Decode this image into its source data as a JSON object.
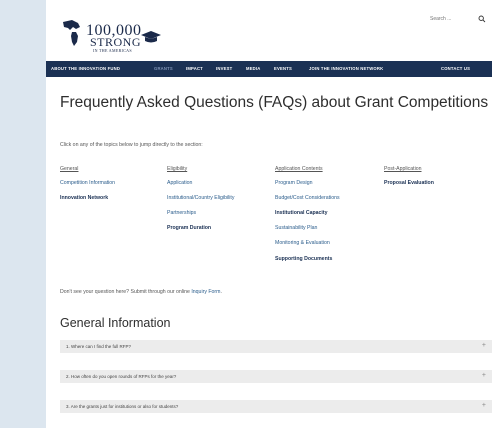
{
  "logo": {
    "title": "100,000",
    "sub1": "STRONG",
    "sub2": "IN THE AMERICAS"
  },
  "search": {
    "placeholder": "Search ..."
  },
  "nav": [
    {
      "label": "ABOUT THE INNOVATION FUND",
      "active": false
    },
    {
      "label": "GRANTS",
      "active": true
    },
    {
      "label": "IMPACT",
      "active": false
    },
    {
      "label": "INVEST",
      "active": false
    },
    {
      "label": "MEDIA",
      "active": false
    },
    {
      "label": "EVENTS",
      "active": false
    },
    {
      "label": "JOIN THE INNOVATION NETWORK",
      "active": false
    },
    {
      "label": "CONTACT US",
      "active": false
    }
  ],
  "page_title": "Frequently Asked Questions (FAQs) about Grant Competitions",
  "intro": "Click on any of the topics below to jump directly to the section:",
  "topics": {
    "col1": [
      "General",
      "Competition Information",
      "Innovation Network"
    ],
    "col2": [
      "Eligibility",
      "Application",
      "Institutional/Country Eligibility",
      "Partnerships",
      "Program Duration"
    ],
    "col3": [
      "Application Contents",
      "Program Design",
      "Budget/Cost Considerations",
      "Institutional Capacity",
      "Sustainability Plan",
      "Monitoring & Evaluation",
      "Supporting Documents"
    ],
    "col4": [
      "Post-Application",
      "Proposal Evaluation"
    ]
  },
  "footer_note": {
    "text": "Don't see your question here? Submit through our online ",
    "link": "Inquiry Form",
    "end": "."
  },
  "section_title": "General Information",
  "faqs": [
    "1. Where can I find the full RFP?",
    "2. How often do you open rounds of RFPs for the year?",
    "3. Are the grants just for institutions or also for students?"
  ],
  "accordion_icon": "+"
}
